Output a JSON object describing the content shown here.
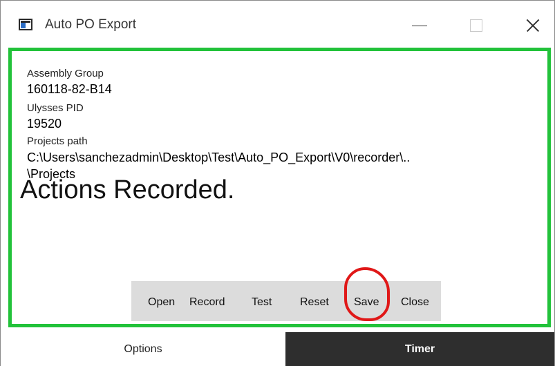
{
  "window": {
    "title": "Auto PO Export",
    "icon": "app-window-icon"
  },
  "fields": {
    "assembly_group_label": "Assembly Group",
    "assembly_group_value": "160118-82-B14",
    "ulysses_pid_label": "Ulysses PID",
    "ulysses_pid_value": "19520",
    "projects_path_label": "Projects path",
    "projects_path_value_line1": "C:\\Users\\sanchezadmin\\Desktop\\Test\\Auto_PO_Export\\V0\\recorder\\..",
    "projects_path_value_line2": "\\Projects"
  },
  "status": {
    "message": "Actions Recorded."
  },
  "toolbar": {
    "open_label": "Open",
    "record_label": "Record",
    "test_label": "Test",
    "reset_label": "Reset",
    "save_label": "Save",
    "close_label": "Close"
  },
  "tabs": [
    {
      "label": "Options",
      "active": true
    },
    {
      "label": "Timer",
      "active": false
    }
  ],
  "colors": {
    "highlight_border": "#22c23a",
    "annotation_circle": "#e01818",
    "toolbar_bg": "#dcdcdc",
    "timer_tab_bg": "#2e2e2e"
  }
}
